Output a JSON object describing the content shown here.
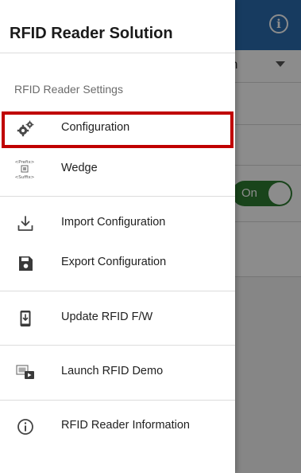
{
  "background": {
    "dropdown_partial_text": "th",
    "toggle_label": "On"
  },
  "drawer": {
    "title": "RFID Reader Solution",
    "section_label": "RFID Reader Settings",
    "items": [
      {
        "label": "Configuration",
        "icon": "gears-icon"
      },
      {
        "label": "Wedge",
        "icon": "wedge-prefix-suffix-icon",
        "icon_text": [
          "<Prefix>",
          "<Suffix>"
        ]
      },
      {
        "label": "Import Configuration",
        "icon": "download-tray-icon"
      },
      {
        "label": "Export Configuration",
        "icon": "floppy-save-icon"
      },
      {
        "label": "Update RFID F/W",
        "icon": "phone-download-icon"
      },
      {
        "label": "Launch RFID Demo",
        "icon": "play-demo-icon"
      },
      {
        "label": "RFID Reader Information",
        "icon": "info-circle-icon"
      }
    ]
  },
  "colors": {
    "appbar": "#2b6cb0",
    "toggle_on": "#2e7d32",
    "highlight": "#c00000"
  }
}
